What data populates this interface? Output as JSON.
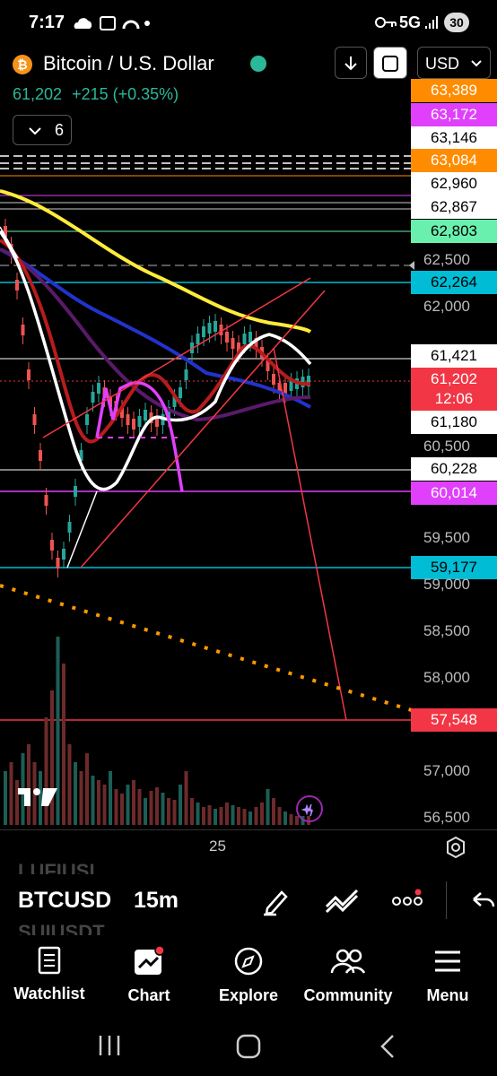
{
  "status_bar": {
    "time": "7:17",
    "network": "5G",
    "battery": "30"
  },
  "header": {
    "title": "Bitcoin / U.S. Dollar",
    "currency": "USD",
    "last_price": "61,202",
    "change": "+215 (+0.35%)",
    "indicator_count": "6"
  },
  "price_axis": {
    "labels": [
      {
        "text": "63,389",
        "bg": "#ff8c00",
        "fg": "#ffffff"
      },
      {
        "text": "63,172",
        "bg": "#e040fb",
        "fg": "#ffffff"
      },
      {
        "text": "63,146",
        "bg": "#ffffff",
        "fg": "#000000"
      },
      {
        "text": "63,084",
        "bg": "#ff8c00",
        "fg": "#ffffff"
      },
      {
        "text": "62,960",
        "bg": "#ffffff",
        "fg": "#000000"
      },
      {
        "text": "62,867",
        "bg": "#ffffff",
        "fg": "#000000"
      },
      {
        "text": "62,803",
        "bg": "#69f0ae",
        "fg": "#000000"
      },
      {
        "text": "62,264",
        "bg": "#00bcd4",
        "fg": "#000000"
      },
      {
        "text": "61,421",
        "bg": "#ffffff",
        "fg": "#000000"
      },
      {
        "text": "61,202",
        "bg": "#f23645",
        "fg": "#ffffff"
      },
      {
        "text": "12:06",
        "bg": "#f23645",
        "fg": "#ffffff"
      },
      {
        "text": "61,180",
        "bg": "#ffffff",
        "fg": "#000000"
      },
      {
        "text": "60,228",
        "bg": "#ffffff",
        "fg": "#000000"
      },
      {
        "text": "60,014",
        "bg": "#e040fb",
        "fg": "#ffffff"
      },
      {
        "text": "59,177",
        "bg": "#00bcd4",
        "fg": "#000000"
      },
      {
        "text": "57,548",
        "bg": "#f23645",
        "fg": "#ffffff"
      }
    ],
    "ticks": [
      "62,500",
      "62,000",
      "60,500",
      "59,500",
      "59,000",
      "58,500",
      "58,000",
      "57,000",
      "56,500"
    ]
  },
  "time_axis": {
    "label": "25"
  },
  "bottom_bar": {
    "symbol": "BTCUSD",
    "symbol_above": "LUFIUSI",
    "symbol_below": "SUIUSDT",
    "interval": "15m"
  },
  "nav": {
    "watchlist": "Watchlist",
    "chart": "Chart",
    "explore": "Explore",
    "community": "Community",
    "menu": "Menu"
  },
  "logo_text": "17"
}
